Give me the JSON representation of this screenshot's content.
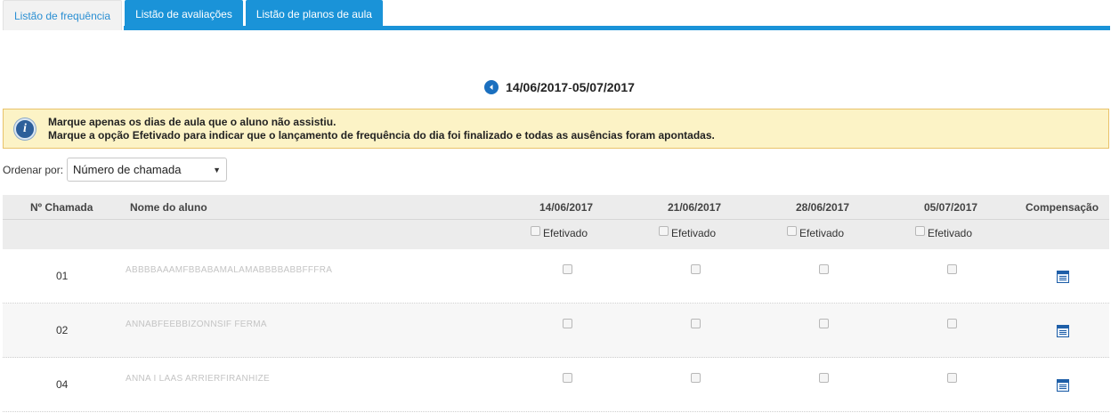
{
  "tabs": [
    {
      "label": "Listão de frequência",
      "active": true
    },
    {
      "label": "Listão de avaliações",
      "active": false
    },
    {
      "label": "Listão de planos de aula",
      "active": false
    }
  ],
  "period": {
    "start": "14/06/2017",
    "separator": " - ",
    "end": "05/07/2017"
  },
  "info": {
    "line1": "Marque apenas os dias de aula que o aluno não assistiu.",
    "line2": "Marque a opção Efetivado para indicar que o lançamento de frequência do dia foi finalizado e todas as ausências foram apontadas."
  },
  "order": {
    "label": "Ordenar por:",
    "selected": "Número de chamada"
  },
  "table": {
    "headers": {
      "number": "Nº Chamada",
      "name": "Nome do aluno",
      "dates": [
        "14/06/2017",
        "21/06/2017",
        "28/06/2017",
        "05/07/2017"
      ],
      "compensation": "Compensação"
    },
    "efetivado_label": "Efetivado",
    "rows": [
      {
        "number": "01",
        "name": "ABBBBAAAMFBBABAMALAMABBBBABBFFFRA"
      },
      {
        "number": "02",
        "name": "ANNABFEEBBIZONNSIF FERMA"
      },
      {
        "number": "04",
        "name": "ANNA I LAAS ARRIERFIRANHIZE"
      }
    ]
  },
  "colors": {
    "accent": "#1a93d8",
    "info_bg": "#fcf3c6",
    "header_bg": "#ececec"
  }
}
